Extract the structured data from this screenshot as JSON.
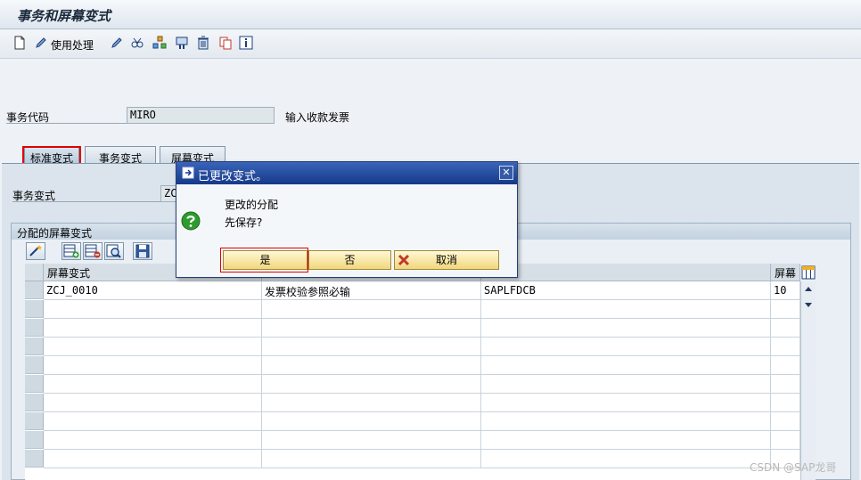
{
  "title": "事务和屏幕变式",
  "toolbar": {
    "use_handle_label": "使用处理"
  },
  "fields": {
    "tcode_label": "事务代码",
    "tcode_value": "MIRO",
    "tcode_desc": "输入收款发票",
    "variant_label": "事务变式",
    "variant_value": "ZC"
  },
  "tabs": [
    {
      "label": "标准变式"
    },
    {
      "label": "事务变式"
    },
    {
      "label": "屏幕变式"
    }
  ],
  "group": {
    "title": "分配的屏幕变式"
  },
  "table": {
    "headers": [
      "屏幕变式",
      "",
      "",
      "屏幕"
    ],
    "rows": [
      {
        "c1": "ZCJ_0010",
        "c2": "发票校验参照必输",
        "c3": "SAPLFDCB",
        "c4": "10"
      }
    ]
  },
  "dialog": {
    "title": "已更改变式。",
    "line1": "更改的分配",
    "line2": "先保存?",
    "btn_yes": "是",
    "btn_no": "否",
    "btn_cancel": "取消",
    "close_glyph": "✕"
  },
  "watermark": "CSDN @SAP龙哥",
  "colors": {
    "title_bar": "#243f7a",
    "highlight": "#e10000",
    "button_yellow": "#f1d77c"
  }
}
